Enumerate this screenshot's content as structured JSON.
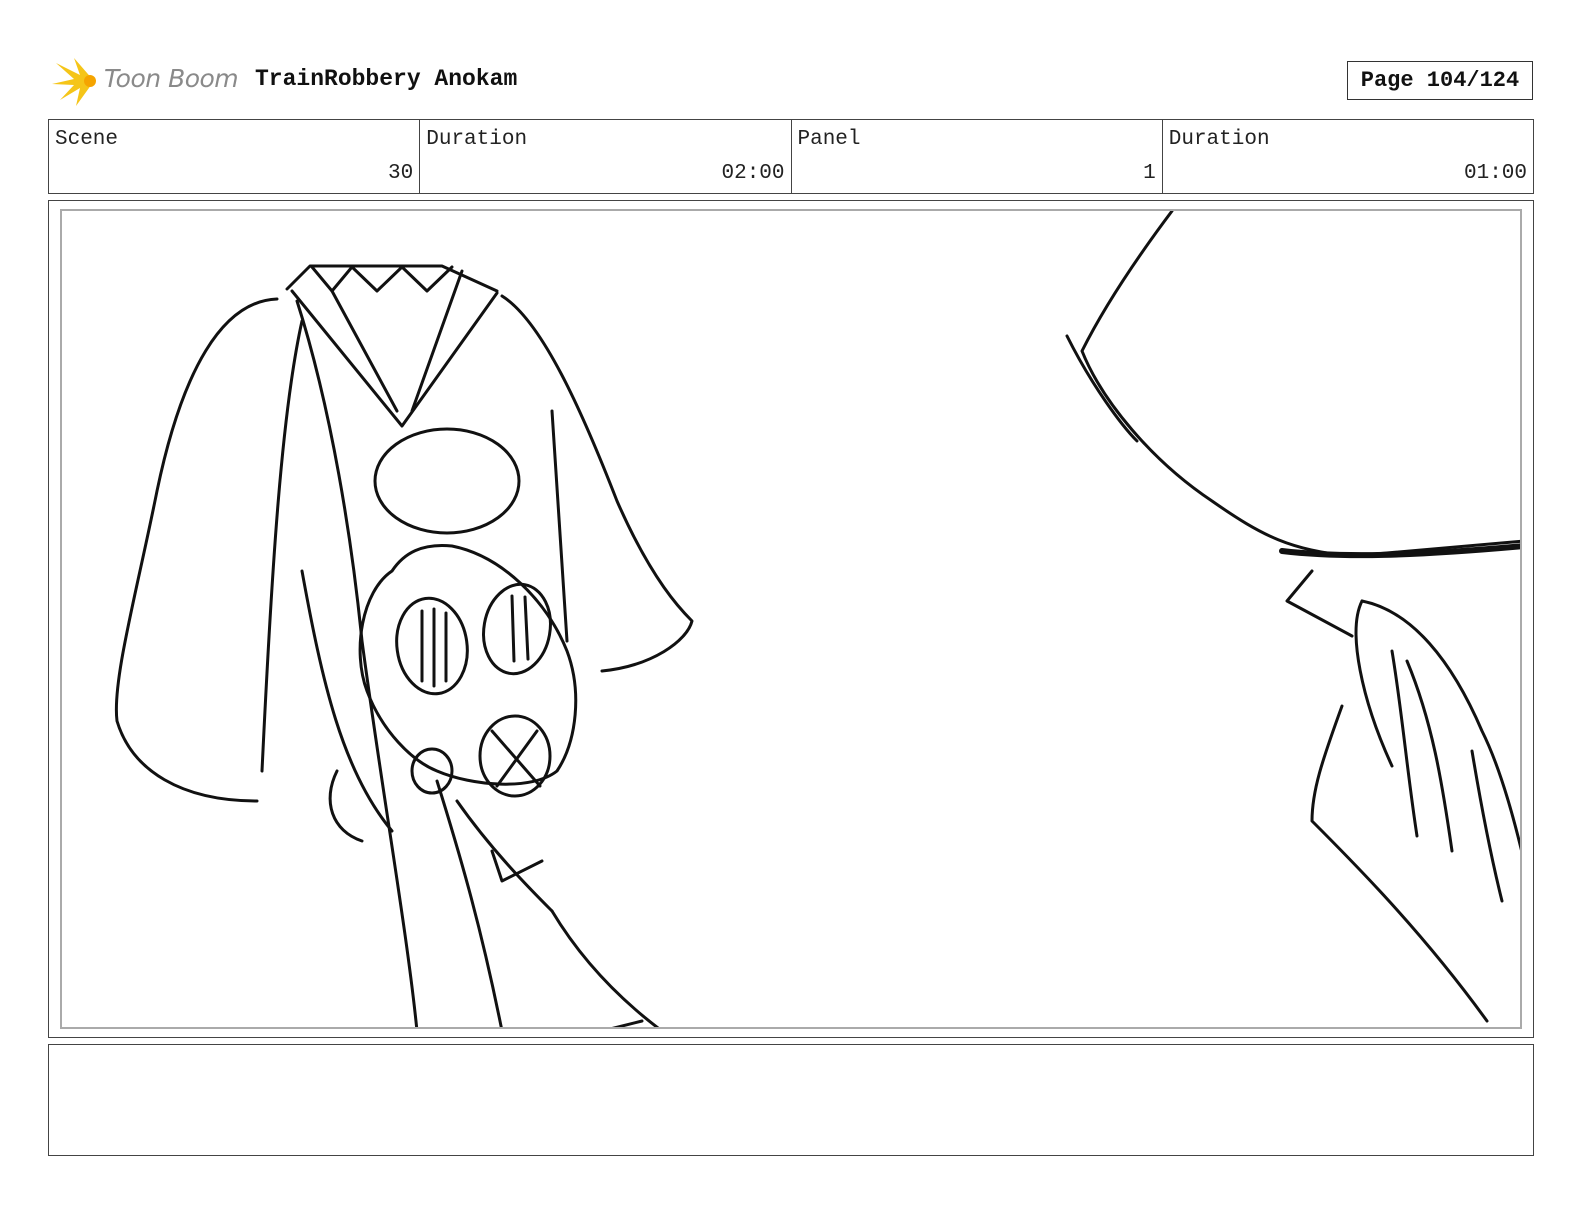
{
  "header": {
    "logo_text": "Toon Boom",
    "project_title": "TrainRobbery Anokam",
    "page_label": "Page 104/124"
  },
  "info": {
    "scene_label": "Scene",
    "scene_value": "30",
    "scene_duration_label": "Duration",
    "scene_duration_value": "02:00",
    "panel_label": "Panel",
    "panel_value": "1",
    "panel_duration_label": "Duration",
    "panel_duration_value": "01:00"
  },
  "colors": {
    "logo_star": "#f5c518",
    "logo_text": "#8a8a8a",
    "frame": "#444444"
  },
  "icons": [
    "toon-boom-star-icon"
  ]
}
